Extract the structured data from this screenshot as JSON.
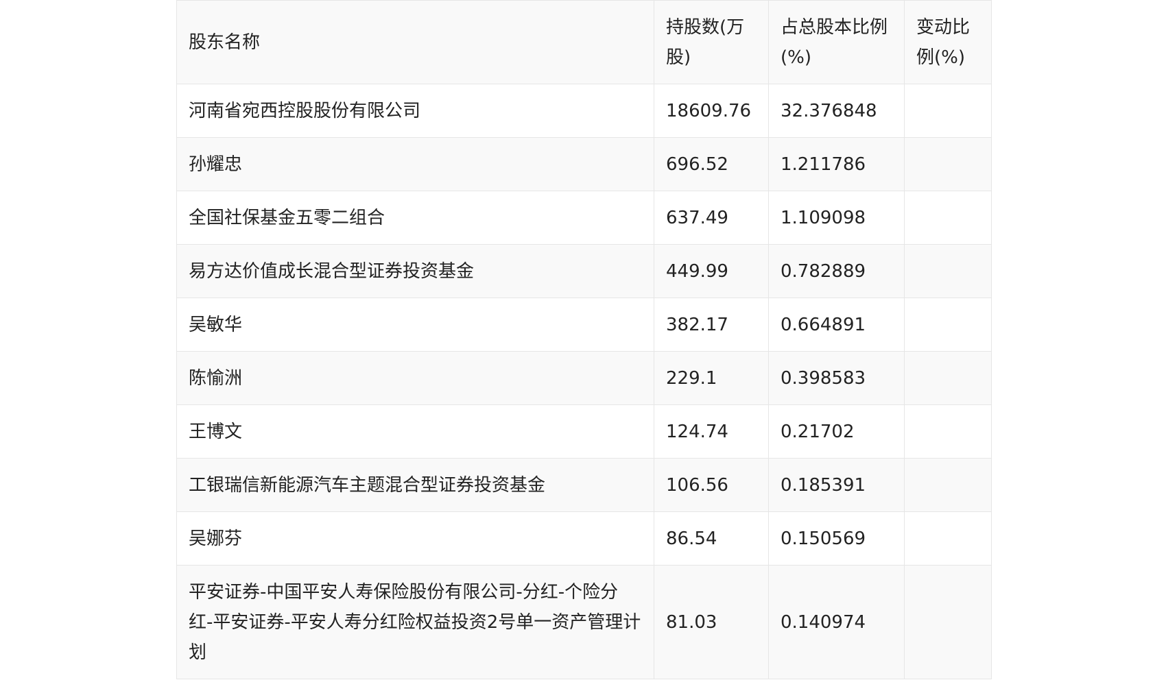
{
  "table": {
    "headers": [
      "股东名称",
      "持股数(万股)",
      "占总股本比例(%)",
      "变动比例(%)"
    ],
    "rows": [
      {
        "name": "河南省宛西控股股份有限公司",
        "shares": "18609.76",
        "ratio": "32.376848",
        "change": ""
      },
      {
        "name": "孙耀忠",
        "shares": "696.52",
        "ratio": "1.211786",
        "change": ""
      },
      {
        "name": "全国社保基金五零二组合",
        "shares": "637.49",
        "ratio": "1.109098",
        "change": ""
      },
      {
        "name": "易方达价值成长混合型证券投资基金",
        "shares": "449.99",
        "ratio": "0.782889",
        "change": ""
      },
      {
        "name": "吴敏华",
        "shares": "382.17",
        "ratio": "0.664891",
        "change": ""
      },
      {
        "name": "陈愉洲",
        "shares": "229.1",
        "ratio": "0.398583",
        "change": ""
      },
      {
        "name": "王博文",
        "shares": "124.74",
        "ratio": "0.21702",
        "change": ""
      },
      {
        "name": "工银瑞信新能源汽车主题混合型证券投资基金",
        "shares": "106.56",
        "ratio": "0.185391",
        "change": ""
      },
      {
        "name": "吴娜芬",
        "shares": "86.54",
        "ratio": "0.150569",
        "change": ""
      },
      {
        "name": "平安证券-中国平安人寿保险股份有限公司-分红-个险分红-平安证券-平安人寿分红险权益投资2号单一资产管理计划",
        "shares": "81.03",
        "ratio": "0.140974",
        "change": ""
      }
    ]
  }
}
